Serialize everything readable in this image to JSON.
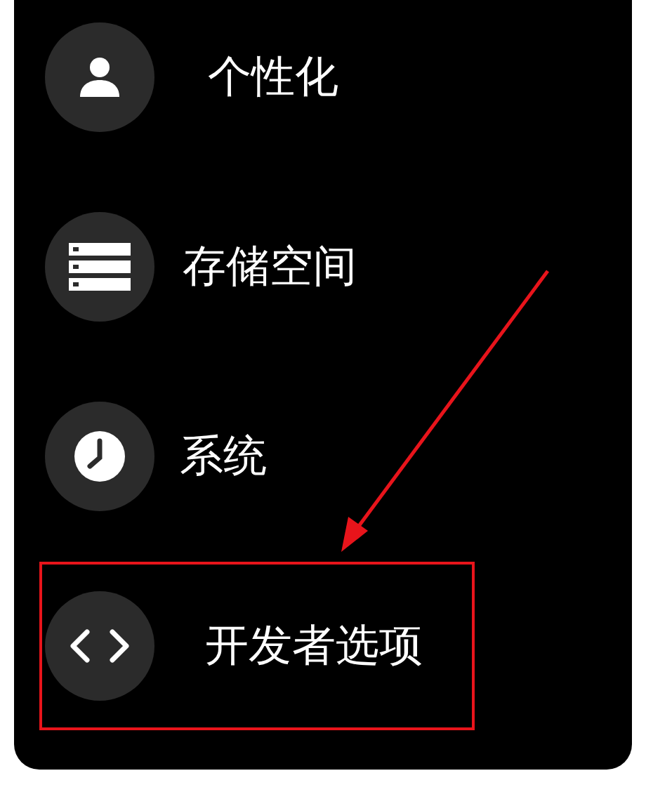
{
  "items": [
    {
      "label": "个性化",
      "kind": "person",
      "highlighted": false
    },
    {
      "label": "存储空间",
      "kind": "storage",
      "highlighted": false
    },
    {
      "label": "系统",
      "kind": "clock",
      "highlighted": false
    },
    {
      "label": "开发者选项",
      "kind": "code",
      "highlighted": true
    }
  ]
}
